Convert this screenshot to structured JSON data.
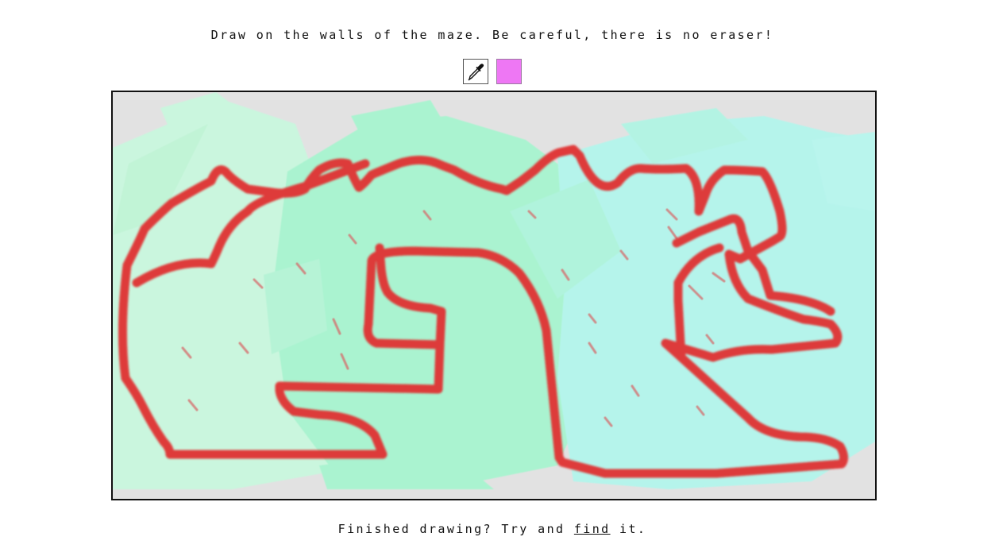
{
  "instruction": "Draw on the walls of the maze. Be careful, there is no eraser!",
  "toolbar": {
    "picker_icon": "eyedropper-icon",
    "current_color": "#ee77f4"
  },
  "canvas": {
    "background_color": "#e2e2e2",
    "stroke_color": "#e03030",
    "fill_colors": [
      "#c8f8de",
      "#a6f5cf",
      "#b2f6ec"
    ]
  },
  "footer": {
    "prefix": "Finished drawing? Try and ",
    "link": "find",
    "suffix": " it."
  }
}
